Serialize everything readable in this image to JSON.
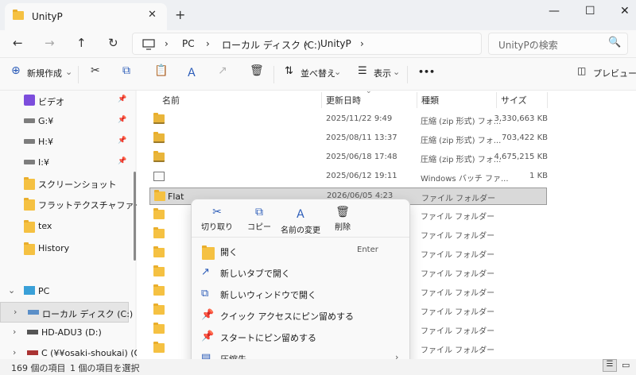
{
  "window": {
    "tab_title": "UnityP",
    "tab_close": "✕",
    "new_tab": "+",
    "minimize": "—",
    "maximize": "☐",
    "close": "✕"
  },
  "nav": {
    "back": "←",
    "forward": "→",
    "up": "↑",
    "refresh": "↻",
    "breadcrumbs": [
      "PC",
      "ローカル ディスク (C:)",
      "UnityP"
    ],
    "separator": "›",
    "search_placeholder": "UnityPの検索",
    "search_icon": "🔍"
  },
  "toolbar": {
    "new_label": "新規作成",
    "sort_label": "並べ替え",
    "view_label": "表示",
    "more": "•••",
    "preview_label": "プレビュー"
  },
  "sidebar": {
    "items": [
      {
        "label": "ビデオ",
        "icon": "video-icon",
        "pin": "📌"
      },
      {
        "label": "G:¥",
        "icon": "drive-icon",
        "pin": "📌"
      },
      {
        "label": "H:¥",
        "icon": "drive-icon",
        "pin": "📌"
      },
      {
        "label": "I:¥",
        "icon": "drive-icon",
        "pin": "📌"
      },
      {
        "label": "スクリーンショット",
        "icon": "folder-icon"
      },
      {
        "label": "フラットテクスチャファイル",
        "icon": "folder-icon"
      },
      {
        "label": "tex",
        "icon": "folder-icon"
      },
      {
        "label": "History",
        "icon": "folder-icon"
      }
    ],
    "pc_label": "PC",
    "drives": [
      {
        "label": "ローカル ディスク (C:)",
        "selected": true
      },
      {
        "label": "HD-ADU3 (D:)",
        "selected": false
      },
      {
        "label": "C (¥¥osaki-shoukai) (O:)",
        "selected": false
      }
    ]
  },
  "columns": {
    "name": "名前",
    "modified": "更新日時",
    "type": "種類",
    "size": "サイズ"
  },
  "rows": [
    {
      "name": "",
      "date": "2025/11/22 9:49",
      "type": "圧縮 (zip 形式) フォ...",
      "size": "3,330,663 KB",
      "icon": "zip"
    },
    {
      "name": "",
      "date": "2025/08/11 13:37",
      "type": "圧縮 (zip 形式) フォ...",
      "size": "703,422 KB",
      "icon": "zip"
    },
    {
      "name": "",
      "date": "2025/06/18 17:48",
      "type": "圧縮 (zip 形式) フォ...",
      "size": "4,675,215 KB",
      "icon": "zip"
    },
    {
      "name": "",
      "date": "2025/06/12 19:11",
      "type": "Windows バッチ ファ...",
      "size": "1 KB",
      "icon": "bat"
    },
    {
      "name": "Flat",
      "date": "2026/06/05 4:23",
      "type": "ファイル フォルダー",
      "size": "",
      "icon": "folder",
      "selected": true
    },
    {
      "name": "",
      "date": "",
      "type": "ファイル フォルダー",
      "size": "",
      "icon": "folder"
    },
    {
      "name": "",
      "date": "",
      "type": "ファイル フォルダー",
      "size": "",
      "icon": "folder"
    },
    {
      "name": "",
      "date": "",
      "type": "ファイル フォルダー",
      "size": "",
      "icon": "folder"
    },
    {
      "name": "",
      "date": "",
      "type": "ファイル フォルダー",
      "size": "",
      "icon": "folder"
    },
    {
      "name": "",
      "date": "",
      "type": "ファイル フォルダー",
      "size": "",
      "icon": "folder"
    },
    {
      "name": "",
      "date": "",
      "type": "ファイル フォルダー",
      "size": "",
      "icon": "folder"
    },
    {
      "name": "",
      "date": "",
      "type": "ファイル フォルダー",
      "size": "",
      "icon": "folder"
    },
    {
      "name": "",
      "date": "",
      "type": "ファイル フォルダー",
      "size": "",
      "icon": "folder"
    }
  ],
  "context_menu": {
    "actions": [
      {
        "label": "切り取り",
        "icon": "✂"
      },
      {
        "label": "コピー",
        "icon": "⧉"
      },
      {
        "label": "名前の変更",
        "icon": "Ａ"
      },
      {
        "label": "削除",
        "icon": "🗑"
      }
    ],
    "items": [
      {
        "label": "開く",
        "shortcut": "Enter",
        "icon": "folder"
      },
      {
        "label": "新しいタブで開く",
        "icon": "↗"
      },
      {
        "label": "新しいウィンドウで開く",
        "icon": "⧉"
      },
      {
        "label": "クイック アクセスにピン留めする",
        "icon": "📌"
      },
      {
        "label": "スタートにピン留めする",
        "icon": "📌"
      },
      {
        "label": "圧縮先...",
        "icon": "▤",
        "arrow": "›"
      }
    ]
  },
  "status": {
    "count": "169 個の項目",
    "selected": "1 個の項目を選択"
  }
}
